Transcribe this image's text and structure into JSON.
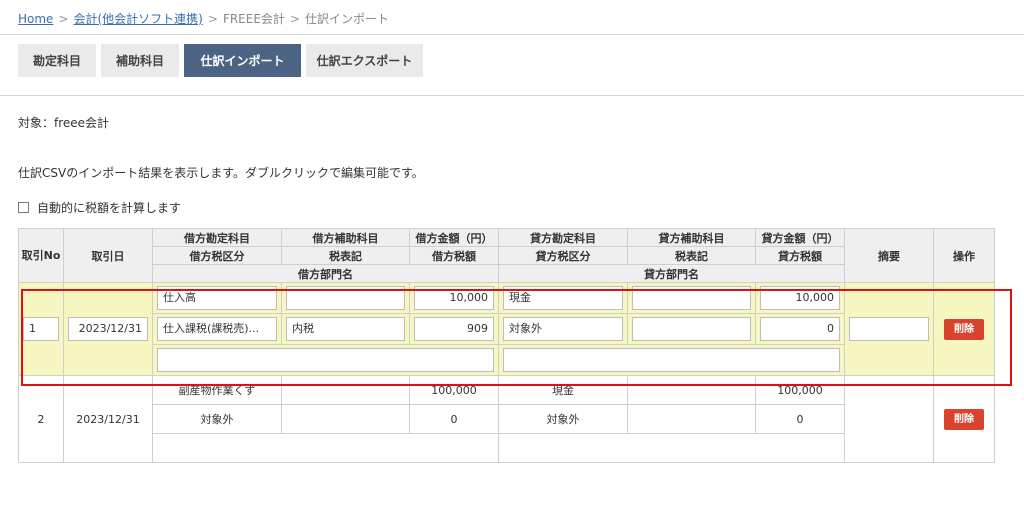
{
  "breadcrumb": {
    "home": "Home",
    "integration": "会計(他会計ソフト連携)",
    "freee": "FREEE会計",
    "current": "仕訳インポート",
    "sep": ">"
  },
  "tabs": [
    "勘定科目",
    "補助科目",
    "仕訳インポート",
    "仕訳エクスポート"
  ],
  "target_text": "対象：freee会計",
  "description": "仕訳CSVのインポート結果を表示します。ダブルクリックで編集可能です。",
  "auto_tax_label": "自動的に税額を計算します",
  "table": {
    "headers": {
      "no": "取引No",
      "date": "取引日",
      "debit_account": "借方勘定科目",
      "debit_sub": "借方補助科目",
      "debit_amount": "借方金額（円）",
      "credit_account": "貸方勘定科目",
      "credit_sub": "貸方補助科目",
      "credit_amount": "貸方金額（円）",
      "memo": "摘要",
      "action": "操作",
      "debit_tax_class": "借方税区分",
      "tax_notation_1": "税表記",
      "debit_tax": "借方税額",
      "credit_tax_class": "貸方税区分",
      "tax_notation_2": "税表記",
      "credit_tax": "貸方税額",
      "debit_dept": "借方部門名",
      "credit_dept": "貸方部門名"
    },
    "rows": [
      {
        "no": "1",
        "date": "2023/12/31",
        "debit_account": "仕入高",
        "debit_sub": "",
        "debit_amount": "10,000",
        "credit_account": "現金",
        "credit_sub": "",
        "credit_amount": "10,000",
        "debit_tax_class": "仕入課税(課税売)...",
        "debit_tax_notation": "内税",
        "debit_tax": "909",
        "credit_tax_class": "対象外",
        "credit_tax_notation": "",
        "credit_tax": "0",
        "memo": "",
        "debit_dept": "",
        "credit_dept": "",
        "delete_label": "削除"
      },
      {
        "no": "2",
        "date": "2023/12/31",
        "debit_account": "副産物作業くず",
        "debit_sub": "",
        "debit_amount": "100,000",
        "credit_account": "現金",
        "credit_sub": "",
        "credit_amount": "100,000",
        "debit_tax_class": "対象外",
        "debit_tax_notation": "",
        "debit_tax": "0",
        "credit_tax_class": "対象外",
        "credit_tax_notation": "",
        "credit_tax": "0",
        "memo": "",
        "debit_dept": "",
        "credit_dept": "",
        "delete_label": "削除"
      }
    ]
  },
  "colors": {
    "active_tab": "#4b6484",
    "highlight_row": "#f7f5c0",
    "delete_button": "#d9432e",
    "selection_frame": "#e01010",
    "link": "#3a6fb0"
  }
}
